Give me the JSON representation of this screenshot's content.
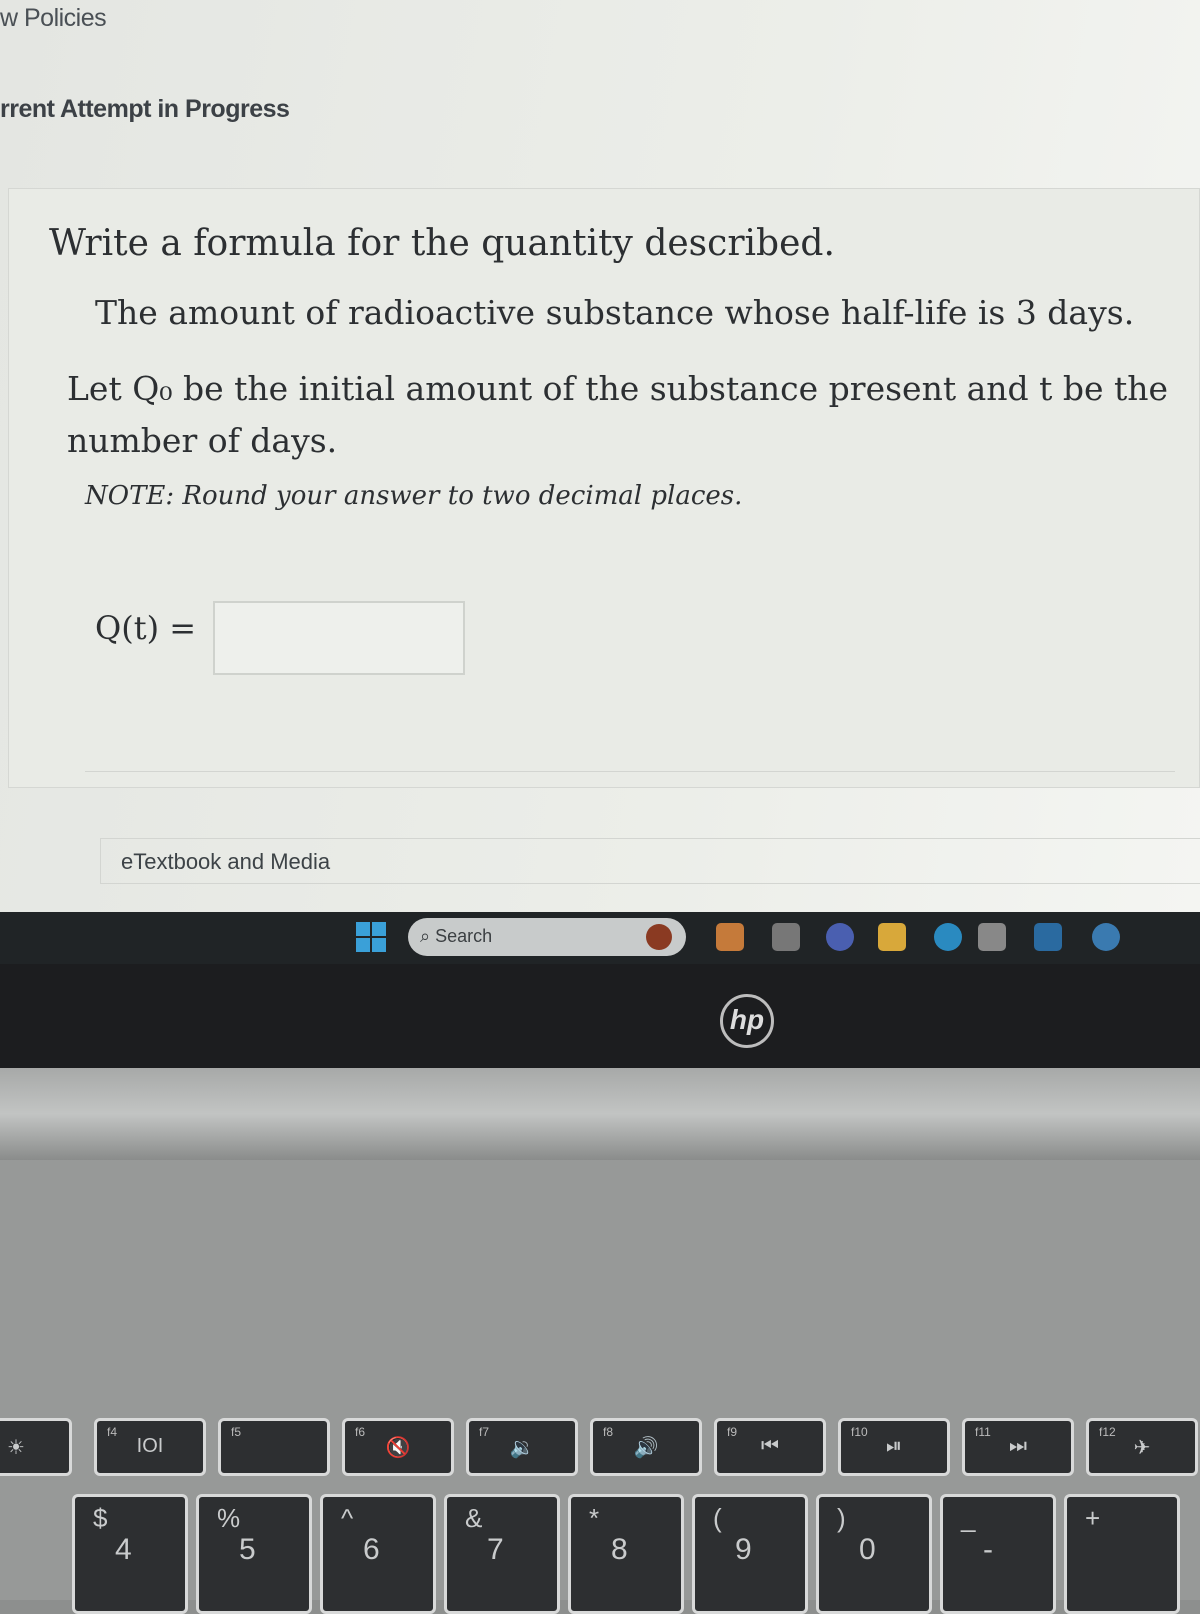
{
  "header": {
    "policies": "w Policies",
    "attempt": "rrent Attempt in Progress"
  },
  "question": {
    "instruction": "Write a formula for the quantity described.",
    "description": "The amount of radioactive substance whose half-life is 3 days.",
    "definitions": "Let Q₀ be the initial amount of the substance present and t be the number of days.",
    "note": "NOTE: Round your answer to two decimal places.",
    "answer_label": "Q(t) =",
    "answer_value": ""
  },
  "etextbook": "eTextbook and Media",
  "taskbar": {
    "search_placeholder": "Search",
    "icons": [
      "windows-start-icon",
      "copilot-icon",
      "task-view-icon",
      "teams-icon",
      "file-explorer-icon",
      "edge-icon",
      "store-icon",
      "wiley-icon",
      "help-icon"
    ]
  },
  "brand": "hp",
  "keyboard": {
    "function_row": [
      {
        "f": "",
        "glyph": "☀"
      },
      {
        "f": "f4",
        "glyph": "IOI"
      },
      {
        "f": "f5",
        "glyph": ""
      },
      {
        "f": "f6",
        "glyph": "🔇"
      },
      {
        "f": "f7",
        "glyph": "🔉"
      },
      {
        "f": "f8",
        "glyph": "🔊"
      },
      {
        "f": "f9",
        "glyph": "⏮"
      },
      {
        "f": "f10",
        "glyph": "⏯"
      },
      {
        "f": "f11",
        "glyph": "⏭"
      },
      {
        "f": "f12",
        "glyph": "✈"
      }
    ],
    "number_row": [
      {
        "top": "$",
        "bottom": "4"
      },
      {
        "top": "%",
        "bottom": "5"
      },
      {
        "top": "^",
        "bottom": "6"
      },
      {
        "top": "&",
        "bottom": "7"
      },
      {
        "top": "*",
        "bottom": "8"
      },
      {
        "top": "(",
        "bottom": "9"
      },
      {
        "top": ")",
        "bottom": "0"
      },
      {
        "top": "_",
        "bottom": "-"
      },
      {
        "top": "+",
        "bottom": ""
      }
    ]
  }
}
